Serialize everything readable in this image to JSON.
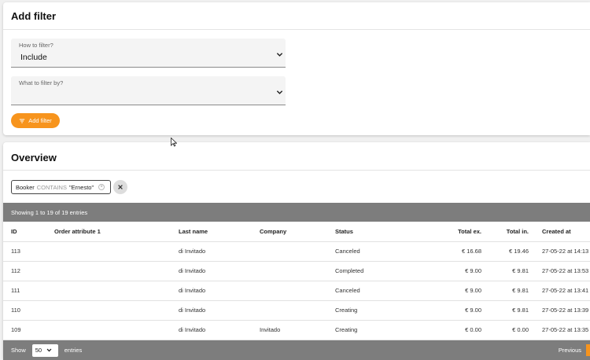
{
  "filter_card": {
    "title": "Add filter",
    "how": {
      "label": "How to filter?",
      "value": "Include"
    },
    "what": {
      "label": "What to filter by?",
      "value": ""
    },
    "add_button": "Add filter"
  },
  "overview_card": {
    "title": "Overview",
    "chip": {
      "field": "Booker",
      "operator": "CONTAINS",
      "value": "\"Ernesto\""
    },
    "info": "Showing 1 to 19 of 19 entries",
    "columns": [
      "ID",
      "Order attribute 1",
      "Last name",
      "Company",
      "Status",
      "Total ex.",
      "Total in.",
      "Created at"
    ],
    "rows": [
      {
        "id": "113",
        "order_attr": "",
        "last_name": "di Invitado",
        "company": "",
        "status": "Canceled",
        "total_ex": "€ 16.68",
        "total_in": "€ 19.46",
        "created": "27-05-22 at 14:13"
      },
      {
        "id": "112",
        "order_attr": "",
        "last_name": "di Invitado",
        "company": "",
        "status": "Completed",
        "total_ex": "€ 9.00",
        "total_in": "€ 9.81",
        "created": "27-05-22 at 13:53"
      },
      {
        "id": "111",
        "order_attr": "",
        "last_name": "di Invitado",
        "company": "",
        "status": "Canceled",
        "total_ex": "€ 9.00",
        "total_in": "€ 9.81",
        "created": "27-05-22 at 13:41"
      },
      {
        "id": "110",
        "order_attr": "",
        "last_name": "di Invitado",
        "company": "",
        "status": "Creating",
        "total_ex": "€ 9.00",
        "total_in": "€ 9.81",
        "created": "27-05-22 at 13:39"
      },
      {
        "id": "109",
        "order_attr": "",
        "last_name": "di Invitado",
        "company": "Invitado",
        "status": "Creating",
        "total_ex": "€ 0.00",
        "total_in": "€ 0.00",
        "created": "27-05-22 at 13:35"
      }
    ],
    "footer": {
      "show": "Show",
      "length": "50",
      "entries": "entries",
      "previous": "Previous"
    }
  },
  "colors": {
    "accent": "#f7941d",
    "bar": "#7d7d7d"
  }
}
